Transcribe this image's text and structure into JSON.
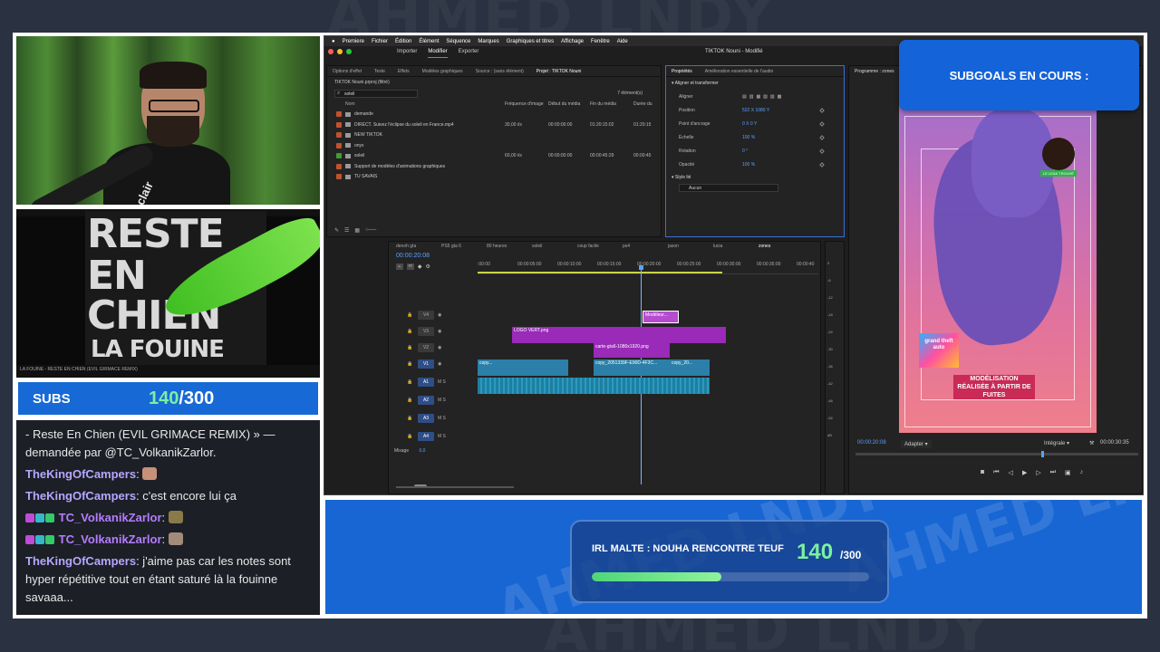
{
  "background": {
    "watermark": "AHMED LNDY"
  },
  "webcam": {
    "mic_brand": "clair"
  },
  "album": {
    "line1": "RESTE",
    "line2": "EN",
    "line3": "CHIEN",
    "line4": "LA FOUINE",
    "player_text": "LA FOUINE - RESTE EN CHIEN (EVIL GRIMACE REMIX)"
  },
  "subs": {
    "label": "SUBS",
    "current": "140",
    "total": "/300",
    "progress": 0.467
  },
  "chat": {
    "messages": [
      {
        "user": "",
        "text": "- Reste En Chien (EVIL GRIMACE REMIX) » — demandée par @TC_VolkanikZarlor."
      },
      {
        "user": "TheKingOfCampers",
        "text": ":",
        "emote": true
      },
      {
        "user": "TheKingOfCampers",
        "text": ": c'est encore lui ça"
      },
      {
        "user": "TC_VolkanikZarlor",
        "text": ":",
        "emote": true,
        "badges": true
      },
      {
        "user": "TC_VolkanikZarlor",
        "text": ":",
        "emote": true,
        "badges": true
      },
      {
        "user": "TheKingOfCampers",
        "text": ": j'aime pas car les notes sont hyper répétitive tout en étant saturé là la fouinne savaaa..."
      }
    ]
  },
  "premiere": {
    "menu": [
      "Premiere",
      "Fichier",
      "Édition",
      "Élément",
      "Séquence",
      "Marques",
      "Graphiques et titres",
      "Affichage",
      "Fenêtre",
      "Aide"
    ],
    "workspace": [
      "Importer",
      "Modifier",
      "Exporter"
    ],
    "active_workspace": "Modifier",
    "doc_title": "TIKTOK Nouni - Modifié",
    "source_tabs": [
      "Options d'effet",
      "Texte",
      "Effets",
      "Modèles graphiques",
      "Source : (sans élément)",
      "Projet : TIKTOK Nouni"
    ],
    "project": {
      "file": "TIKTOK Nouni.prproj (filtré)",
      "search": "soleil",
      "count": "7 élément(s)",
      "headers": [
        "Nom",
        "Fréquence d'image",
        "Début du média",
        "Fin du média",
        "Durée du"
      ],
      "rows": [
        {
          "name": "demande",
          "fps": "",
          "start": "",
          "end": "",
          "dur": "",
          "color": "#c0532e"
        },
        {
          "name": "DIRECT. Suivez l'éclipse du soleil en France.mp4",
          "fps": "30,00 i/s",
          "start": "00:00:00:00",
          "end": "01:20:15:02",
          "dur": "01:20:15",
          "color": "#c0532e"
        },
        {
          "name": "NEW TIKTOK",
          "fps": "",
          "start": "",
          "end": "",
          "dur": "",
          "color": "#c0532e"
        },
        {
          "name": "onyx",
          "fps": "",
          "start": "",
          "end": "",
          "dur": "",
          "color": "#c0532e"
        },
        {
          "name": "soleil",
          "fps": "60,00 i/s",
          "start": "00:00:00:00",
          "end": "00:00:45:29",
          "dur": "00:00:45",
          "color": "#3f9a3a"
        },
        {
          "name": "Support de modèles d'animations graphiques",
          "fps": "",
          "start": "",
          "end": "",
          "dur": "",
          "color": "#c0532e"
        },
        {
          "name": "TU SAVAIS",
          "fps": "",
          "start": "",
          "end": "",
          "dur": "",
          "color": "#c0532e"
        }
      ]
    },
    "props": {
      "tabs": [
        "Propriétés",
        "Amélioration essentielle de l'audio"
      ],
      "section": "Aligner et transformer",
      "rows": [
        {
          "label": "Aligner",
          "value": ""
        },
        {
          "label": "Position",
          "value": "522 X   1080 Y"
        },
        {
          "label": "Point d'ancrage",
          "value": "0 X   0 Y"
        },
        {
          "label": "Échelle",
          "value": "100 %"
        },
        {
          "label": "Rotation",
          "value": "0 °"
        },
        {
          "label": "Opacité",
          "value": "100 %"
        }
      ],
      "style_section": "Style lié",
      "style_value": "Aucun"
    },
    "timeline": {
      "timecode": "00:00:20:08",
      "seq_tabs": [
        "denoh gta",
        "PS5 gta 6",
        "80 heures",
        "soleil",
        "coup facile",
        "ps4",
        "jason",
        "lucia",
        "zones"
      ],
      "ruler": [
        ":00:00",
        "00:00:05:00",
        "00:00:10:00",
        "00:00:15:00",
        "00:00:20:00",
        "00:00:25:00",
        "00:00:30:00",
        "00:00:35:00",
        "00:00:40"
      ],
      "tracks_video": [
        "V4",
        "V3",
        "V2",
        "V1"
      ],
      "tracks_audio": [
        "A1",
        "A2",
        "A3",
        "A4"
      ],
      "mix_label": "Mixage",
      "mix_value": "0,0",
      "clips": {
        "v4": "Modèleur...",
        "v3": "LOGO VERT.png",
        "v2": "carte-gta6-1080x1920.png",
        "v1a": "copy...",
        "v1b": "copy_2051339F-E90D-4F3C...",
        "v1c": "copy_20..."
      }
    },
    "program": {
      "title": "Programme : zones",
      "timecode": "00:00:20:08",
      "fit": "Adapter",
      "quality": "Intégrale",
      "duration": "00:00:30:35",
      "overlay_text": "MODÉLISATION RÉALISÉE À PARTIR DE FUITES",
      "logo_text": "grand theft auto",
      "badge_text": "LE LEAK TROUVÉ"
    },
    "audio_meter": [
      "0",
      "-6",
      "-12",
      "-18",
      "-24",
      "-30",
      "-36",
      "-42",
      "-48",
      "-54",
      "dB"
    ]
  },
  "subgoals": {
    "title": "SUBGOALS EN COURS :"
  },
  "goal": {
    "text": "IRL MALTE : NOUHA RENCONTRE TEUF",
    "current": "140",
    "total": "/300",
    "progress": 0.467
  }
}
